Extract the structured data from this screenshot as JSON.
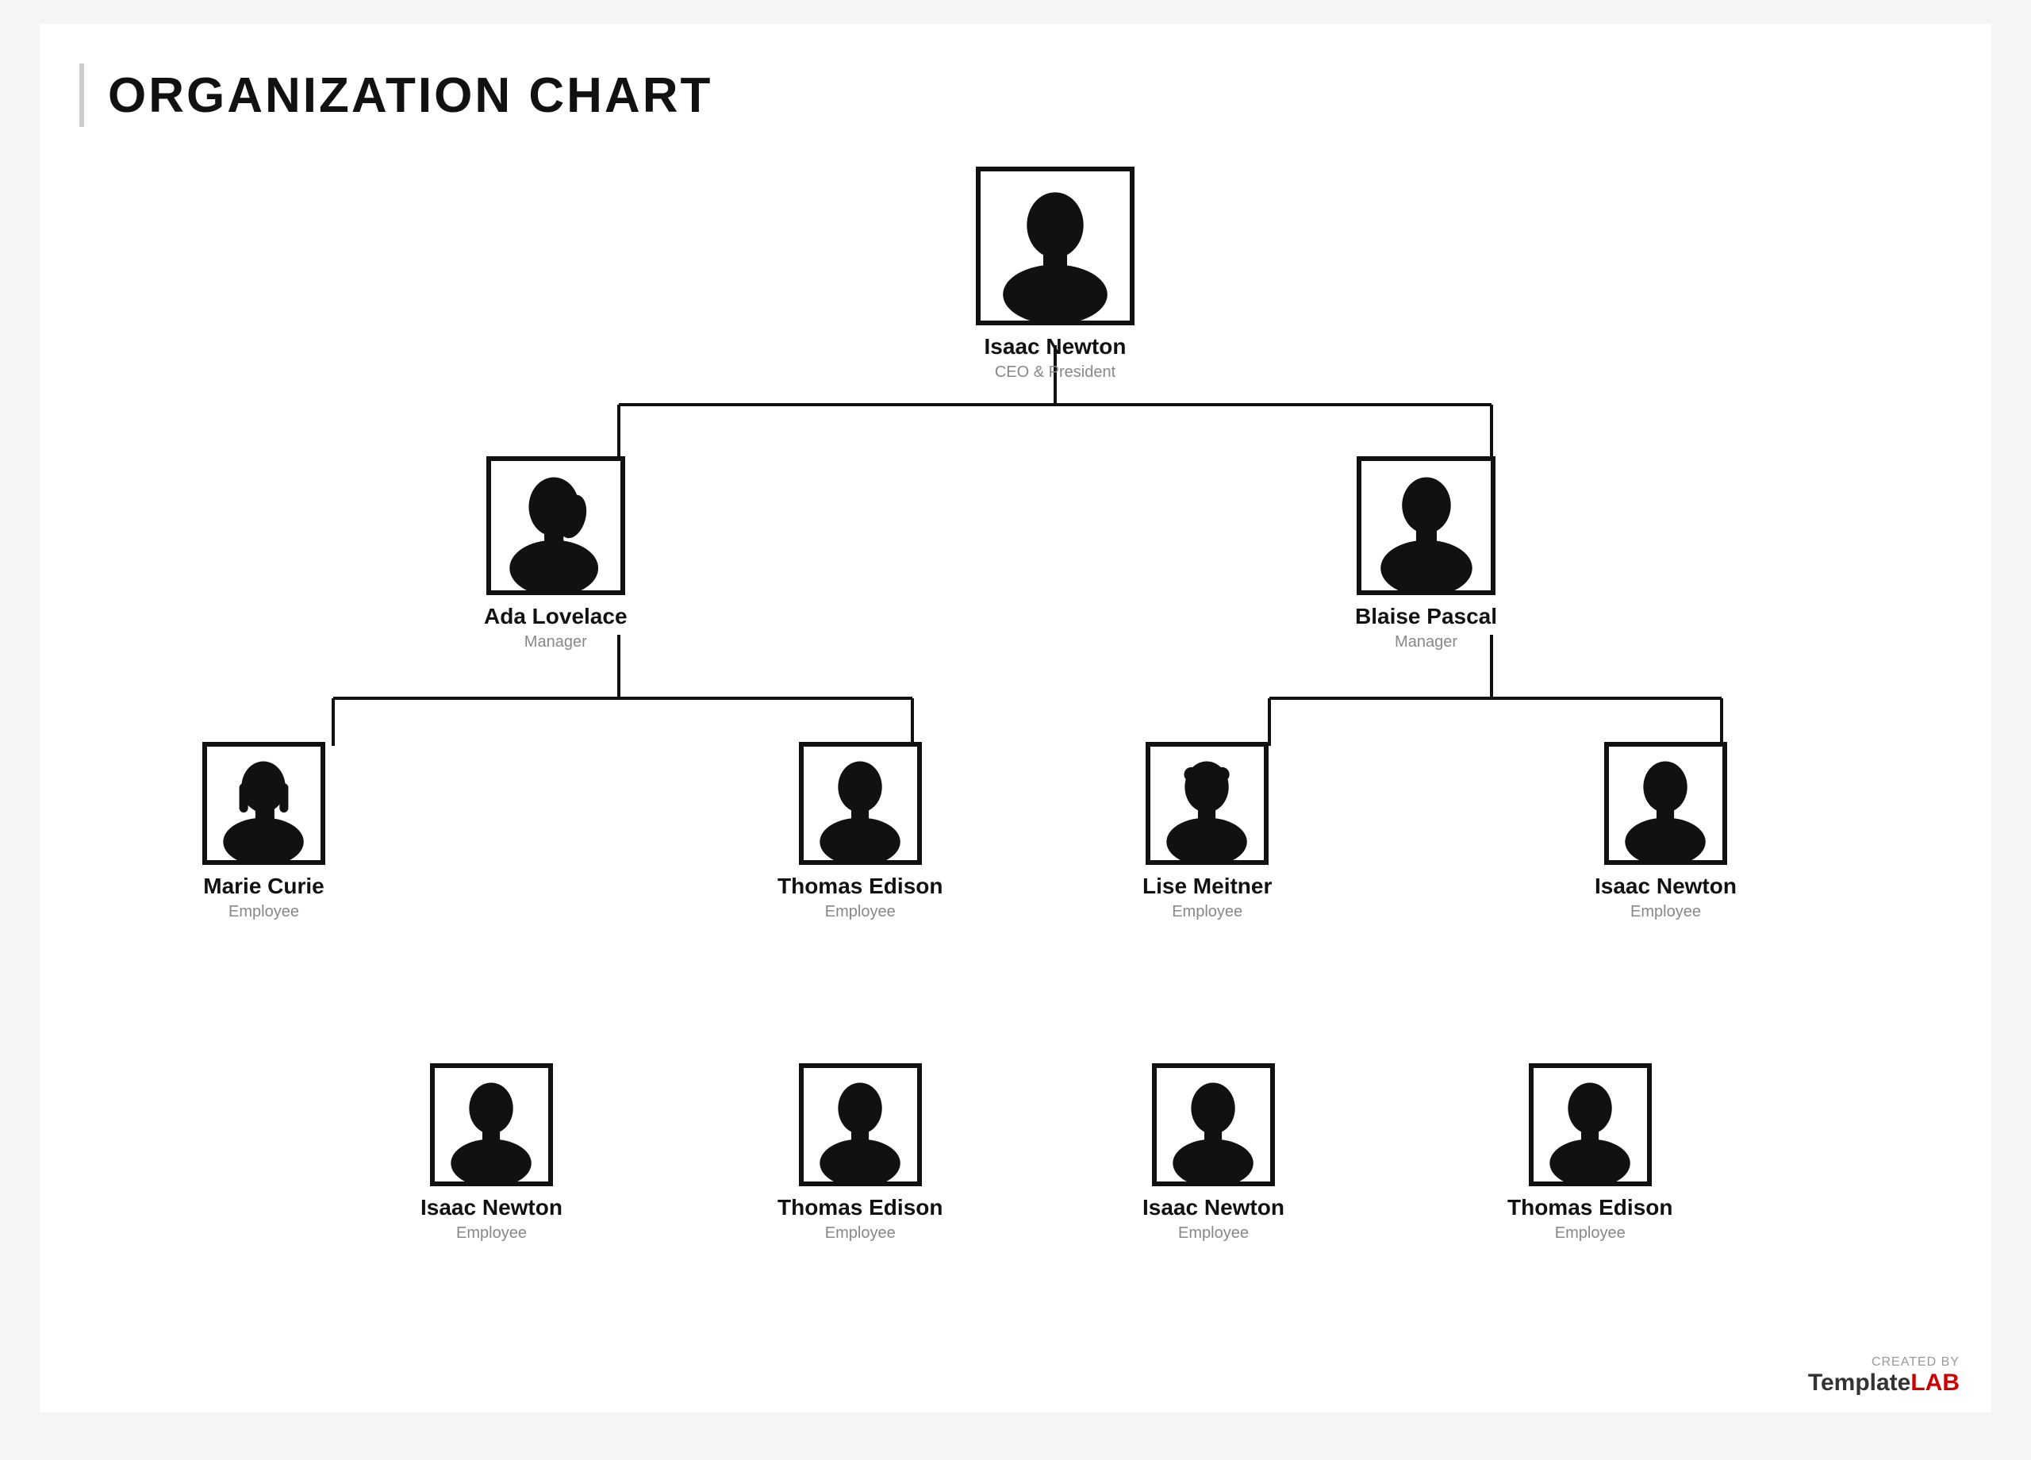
{
  "title": "ORGANIZATION CHART",
  "watermark": {
    "created_by": "CREATED BY",
    "brand_template": "Template",
    "brand_lab": "LAB"
  },
  "nodes": {
    "ceo": {
      "name": "Isaac Newton",
      "role": "CEO & President"
    },
    "manager_left": {
      "name": "Ada Lovelace",
      "role": "Manager"
    },
    "manager_right": {
      "name": "Blaise Pascal",
      "role": "Manager"
    },
    "row2_1": {
      "name": "Marie Curie",
      "role": "Employee"
    },
    "row2_2": {
      "name": "Thomas Edison",
      "role": "Employee"
    },
    "row2_3": {
      "name": "Lise Meitner",
      "role": "Employee"
    },
    "row2_4": {
      "name": "Isaac Newton",
      "role": "Employee"
    },
    "row3_1": {
      "name": "Isaac Newton",
      "role": "Employee"
    },
    "row3_2": {
      "name": "Thomas Edison",
      "role": "Employee"
    },
    "row3_3": {
      "name": "Isaac Newton",
      "role": "Employee"
    },
    "row3_4": {
      "name": "Thomas Edison",
      "role": "Employee"
    }
  }
}
